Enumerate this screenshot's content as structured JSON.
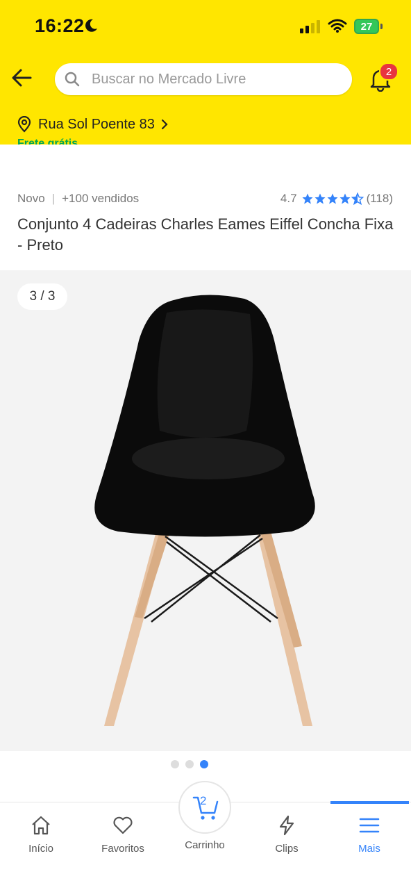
{
  "status": {
    "time": "16:22",
    "battery": "27"
  },
  "header": {
    "search_placeholder": "Buscar no Mercado Livre",
    "notification_count": "2",
    "address": "Rua Sol Poente 83",
    "shipping_partial": "Frete grátis"
  },
  "product": {
    "condition": "Novo",
    "sold": "+100 vendidos",
    "rating": "4.7",
    "reviews": "(118)",
    "title": "Conjunto 4 Cadeiras Charles Eames Eiffel Concha Fixa - Preto",
    "image_counter": "3 / 3",
    "stars_filled": 4.5
  },
  "carousel": {
    "total": 3,
    "active": 3
  },
  "nav": {
    "items": [
      {
        "label": "Início",
        "icon": "home-icon"
      },
      {
        "label": "Favoritos",
        "icon": "heart-icon"
      },
      {
        "label": "Carrinho",
        "icon": "cart-icon",
        "badge": "2"
      },
      {
        "label": "Clips",
        "icon": "bolt-icon"
      },
      {
        "label": "Mais",
        "icon": "menu-icon"
      }
    ],
    "active": "Mais"
  },
  "colors": {
    "brand_yellow": "#FFE600",
    "accent_blue": "#3483fa",
    "badge_red": "#e8353f",
    "green": "#00a650"
  }
}
